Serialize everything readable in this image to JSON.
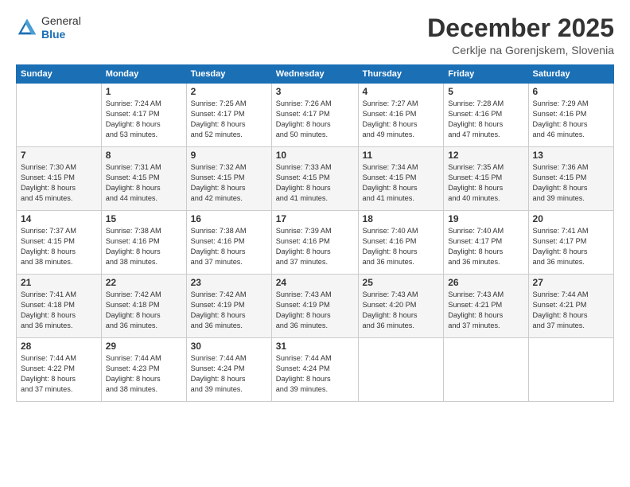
{
  "header": {
    "logo_line1": "General",
    "logo_line2": "Blue",
    "month_title": "December 2025",
    "location": "Cerklje na Gorenjskem, Slovenia"
  },
  "calendar": {
    "days_of_week": [
      "Sunday",
      "Monday",
      "Tuesday",
      "Wednesday",
      "Thursday",
      "Friday",
      "Saturday"
    ],
    "weeks": [
      [
        {
          "day": "",
          "info": ""
        },
        {
          "day": "1",
          "info": "Sunrise: 7:24 AM\nSunset: 4:17 PM\nDaylight: 8 hours\nand 53 minutes."
        },
        {
          "day": "2",
          "info": "Sunrise: 7:25 AM\nSunset: 4:17 PM\nDaylight: 8 hours\nand 52 minutes."
        },
        {
          "day": "3",
          "info": "Sunrise: 7:26 AM\nSunset: 4:17 PM\nDaylight: 8 hours\nand 50 minutes."
        },
        {
          "day": "4",
          "info": "Sunrise: 7:27 AM\nSunset: 4:16 PM\nDaylight: 8 hours\nand 49 minutes."
        },
        {
          "day": "5",
          "info": "Sunrise: 7:28 AM\nSunset: 4:16 PM\nDaylight: 8 hours\nand 47 minutes."
        },
        {
          "day": "6",
          "info": "Sunrise: 7:29 AM\nSunset: 4:16 PM\nDaylight: 8 hours\nand 46 minutes."
        }
      ],
      [
        {
          "day": "7",
          "info": "Sunrise: 7:30 AM\nSunset: 4:15 PM\nDaylight: 8 hours\nand 45 minutes."
        },
        {
          "day": "8",
          "info": "Sunrise: 7:31 AM\nSunset: 4:15 PM\nDaylight: 8 hours\nand 44 minutes."
        },
        {
          "day": "9",
          "info": "Sunrise: 7:32 AM\nSunset: 4:15 PM\nDaylight: 8 hours\nand 42 minutes."
        },
        {
          "day": "10",
          "info": "Sunrise: 7:33 AM\nSunset: 4:15 PM\nDaylight: 8 hours\nand 41 minutes."
        },
        {
          "day": "11",
          "info": "Sunrise: 7:34 AM\nSunset: 4:15 PM\nDaylight: 8 hours\nand 41 minutes."
        },
        {
          "day": "12",
          "info": "Sunrise: 7:35 AM\nSunset: 4:15 PM\nDaylight: 8 hours\nand 40 minutes."
        },
        {
          "day": "13",
          "info": "Sunrise: 7:36 AM\nSunset: 4:15 PM\nDaylight: 8 hours\nand 39 minutes."
        }
      ],
      [
        {
          "day": "14",
          "info": "Sunrise: 7:37 AM\nSunset: 4:15 PM\nDaylight: 8 hours\nand 38 minutes."
        },
        {
          "day": "15",
          "info": "Sunrise: 7:38 AM\nSunset: 4:16 PM\nDaylight: 8 hours\nand 38 minutes."
        },
        {
          "day": "16",
          "info": "Sunrise: 7:38 AM\nSunset: 4:16 PM\nDaylight: 8 hours\nand 37 minutes."
        },
        {
          "day": "17",
          "info": "Sunrise: 7:39 AM\nSunset: 4:16 PM\nDaylight: 8 hours\nand 37 minutes."
        },
        {
          "day": "18",
          "info": "Sunrise: 7:40 AM\nSunset: 4:16 PM\nDaylight: 8 hours\nand 36 minutes."
        },
        {
          "day": "19",
          "info": "Sunrise: 7:40 AM\nSunset: 4:17 PM\nDaylight: 8 hours\nand 36 minutes."
        },
        {
          "day": "20",
          "info": "Sunrise: 7:41 AM\nSunset: 4:17 PM\nDaylight: 8 hours\nand 36 minutes."
        }
      ],
      [
        {
          "day": "21",
          "info": "Sunrise: 7:41 AM\nSunset: 4:18 PM\nDaylight: 8 hours\nand 36 minutes."
        },
        {
          "day": "22",
          "info": "Sunrise: 7:42 AM\nSunset: 4:18 PM\nDaylight: 8 hours\nand 36 minutes."
        },
        {
          "day": "23",
          "info": "Sunrise: 7:42 AM\nSunset: 4:19 PM\nDaylight: 8 hours\nand 36 minutes."
        },
        {
          "day": "24",
          "info": "Sunrise: 7:43 AM\nSunset: 4:19 PM\nDaylight: 8 hours\nand 36 minutes."
        },
        {
          "day": "25",
          "info": "Sunrise: 7:43 AM\nSunset: 4:20 PM\nDaylight: 8 hours\nand 36 minutes."
        },
        {
          "day": "26",
          "info": "Sunrise: 7:43 AM\nSunset: 4:21 PM\nDaylight: 8 hours\nand 37 minutes."
        },
        {
          "day": "27",
          "info": "Sunrise: 7:44 AM\nSunset: 4:21 PM\nDaylight: 8 hours\nand 37 minutes."
        }
      ],
      [
        {
          "day": "28",
          "info": "Sunrise: 7:44 AM\nSunset: 4:22 PM\nDaylight: 8 hours\nand 37 minutes."
        },
        {
          "day": "29",
          "info": "Sunrise: 7:44 AM\nSunset: 4:23 PM\nDaylight: 8 hours\nand 38 minutes."
        },
        {
          "day": "30",
          "info": "Sunrise: 7:44 AM\nSunset: 4:24 PM\nDaylight: 8 hours\nand 39 minutes."
        },
        {
          "day": "31",
          "info": "Sunrise: 7:44 AM\nSunset: 4:24 PM\nDaylight: 8 hours\nand 39 minutes."
        },
        {
          "day": "",
          "info": ""
        },
        {
          "day": "",
          "info": ""
        },
        {
          "day": "",
          "info": ""
        }
      ]
    ]
  }
}
